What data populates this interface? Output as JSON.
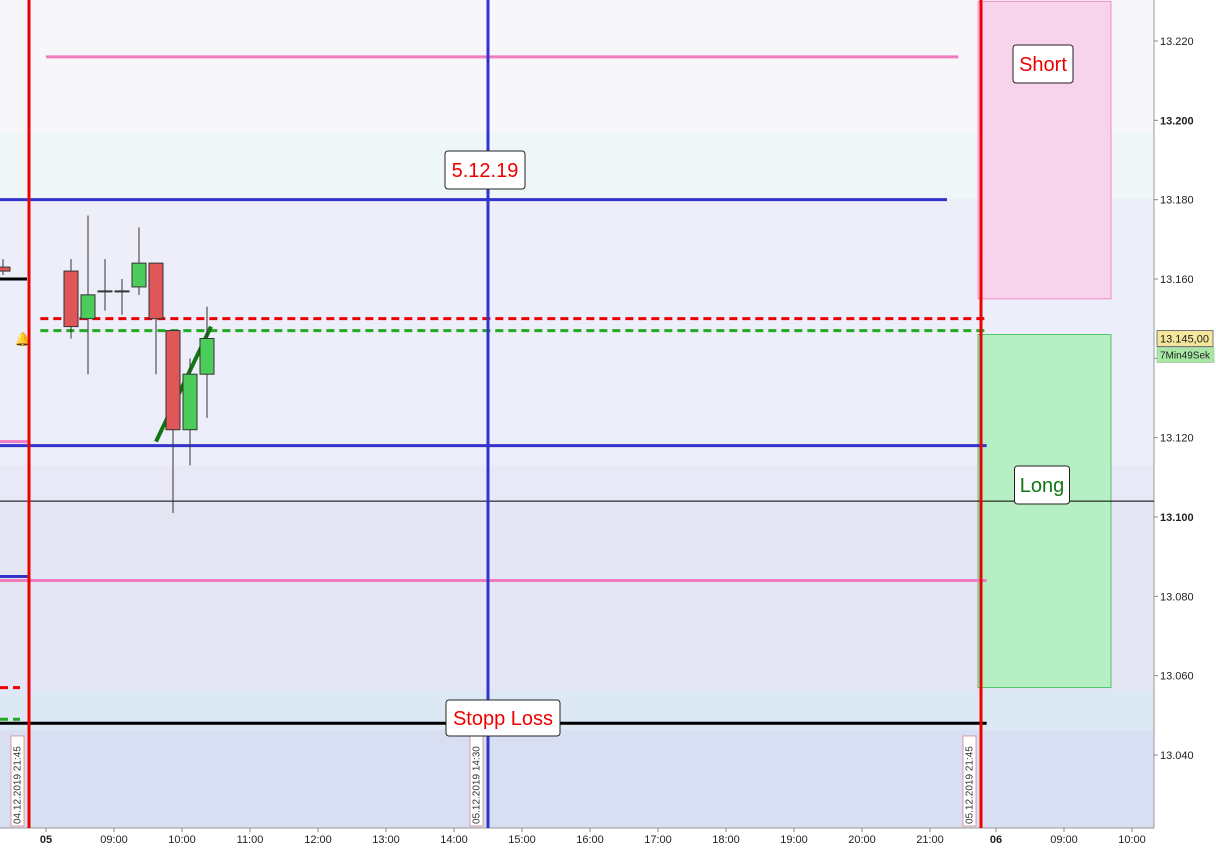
{
  "chart_data": {
    "type": "candlestick",
    "instrument_price_unit": "points",
    "ylim": [
      13025,
      13230
    ],
    "y_axis_ticks": [
      "13.040",
      "13.060",
      "13.080",
      "13.100",
      "13.120",
      "13.140",
      "13.160",
      "13.180",
      "13.200",
      "13.220"
    ],
    "y_axis_bold_ticks": [
      "13.100",
      "13.200"
    ],
    "x_axis_ticks": [
      {
        "label": "05",
        "time": "2019-12-05 08:00",
        "bold": true
      },
      {
        "label": "09:00",
        "time": "2019-12-05 09:00"
      },
      {
        "label": "10:00",
        "time": "2019-12-05 10:00"
      },
      {
        "label": "11:00",
        "time": "2019-12-05 11:00"
      },
      {
        "label": "12:00",
        "time": "2019-12-05 12:00"
      },
      {
        "label": "13:00",
        "time": "2019-12-05 13:00"
      },
      {
        "label": "14:00",
        "time": "2019-12-05 14:00"
      },
      {
        "label": "15:00",
        "time": "2019-12-05 15:00"
      },
      {
        "label": "16:00",
        "time": "2019-12-05 16:00"
      },
      {
        "label": "17:00",
        "time": "2019-12-05 17:00"
      },
      {
        "label": "18:00",
        "time": "2019-12-05 18:00"
      },
      {
        "label": "19:00",
        "time": "2019-12-05 19:00"
      },
      {
        "label": "20:00",
        "time": "2019-12-05 20:00"
      },
      {
        "label": "21:00",
        "time": "2019-12-05 21:00"
      },
      {
        "label": "06",
        "time": "2019-12-06 08:00",
        "bold": true
      },
      {
        "label": "09:00",
        "time": "2019-12-06 09:00"
      },
      {
        "label": "10:00",
        "time": "2019-12-06 10:00"
      }
    ],
    "candles": [
      {
        "time": "2019-12-04 21:00",
        "open": 13163,
        "high": 13165,
        "low": 13162,
        "close": 13164
      },
      {
        "time": "2019-12-04 21:15",
        "open": 13163,
        "high": 13165,
        "low": 13161,
        "close": 13162
      },
      {
        "time": "2019-12-05 08:15",
        "open": 13162,
        "high": 13165,
        "low": 13145,
        "close": 13148
      },
      {
        "time": "2019-12-05 08:30",
        "open": 13150,
        "high": 13176,
        "low": 13136,
        "close": 13156
      },
      {
        "time": "2019-12-05 08:45",
        "open": 13157,
        "high": 13165,
        "low": 13152,
        "close": 13157
      },
      {
        "time": "2019-12-05 09:00",
        "open": 13157,
        "high": 13160,
        "low": 13151,
        "close": 13157
      },
      {
        "time": "2019-12-05 09:15",
        "open": 13158,
        "high": 13173,
        "low": 13156,
        "close": 13164
      },
      {
        "time": "2019-12-05 09:30",
        "open": 13164,
        "high": 13164,
        "low": 13136,
        "close": 13150
      },
      {
        "time": "2019-12-05 09:45",
        "open": 13147,
        "high": 13147,
        "low": 13101,
        "close": 13122
      },
      {
        "time": "2019-12-05 10:00",
        "open": 13122,
        "high": 13140,
        "low": 13113,
        "close": 13136
      },
      {
        "time": "2019-12-05 10:15",
        "open": 13136,
        "high": 13153,
        "low": 13125,
        "close": 13145
      }
    ],
    "horizontal_lines": [
      {
        "role": "top-line",
        "price": 13216,
        "color": "#f07cbf",
        "style": "solid",
        "from": "2019-12-05 08:00",
        "to": "2019-12-05 21:25"
      },
      {
        "role": "resistance",
        "price": 13180,
        "color": "#3333cc",
        "style": "solid",
        "from": "2019-12-04 21:00",
        "to": "2019-12-05 21:15"
      },
      {
        "role": "red-dashed",
        "price": 13150,
        "color": "#ee0000",
        "style": "dashed",
        "from": "2019-12-04 21:55",
        "to": "2019-12-05 21:50"
      },
      {
        "role": "green-dashed",
        "price": 13147,
        "color": "#22aa22",
        "style": "dashed",
        "from": "2019-12-04 21:55",
        "to": "2019-12-05 21:50"
      },
      {
        "role": "support",
        "price": 13118,
        "color": "#3333cc",
        "style": "solid",
        "from": "2019-12-04 21:15",
        "to": "2019-12-05 21:50"
      },
      {
        "role": "current-price",
        "price": 13104,
        "color": "#000000",
        "style": "thin",
        "from": "2019-12-04 20:45",
        "to": "2019-12-06 11:00"
      },
      {
        "role": "bottom-line",
        "price": 13084,
        "color": "#f07cbf",
        "style": "solid",
        "from": "2019-12-04 21:15",
        "to": "2019-12-05 21:50"
      },
      {
        "role": "stop-loss",
        "price": 13048,
        "color": "#000000",
        "style": "solid",
        "from": "2019-12-04 21:15",
        "to": "2019-12-05 21:50"
      }
    ],
    "trend_line": {
      "color": "#117711",
      "from": {
        "time": "2019-12-05 09:45",
        "price": 13119
      },
      "to": {
        "time": "2019-12-05 10:15",
        "price": 13148
      }
    },
    "zones": [
      {
        "name": "short-zone",
        "from_price": 13155,
        "to_price": 13230,
        "color": "#f7d4ec"
      },
      {
        "name": "long-zone",
        "from_price": 13057,
        "to_price": 13146,
        "color": "#b7efc4"
      }
    ],
    "vertical_lines": [
      {
        "time": "2019-12-04 21:45",
        "label": "04.12.2019 21:45",
        "color": "#ee0000"
      },
      {
        "time": "2019-12-05 14:30",
        "label": "05.12.2019 14:30",
        "color": "#3333cc"
      },
      {
        "time": "2019-12-05 21:45",
        "label": "05.12.2019 21:45",
        "color": "#ee0000"
      }
    ],
    "annotations": [
      {
        "name": "short-label",
        "text": "Short",
        "color": "#ee0000"
      },
      {
        "name": "date-label",
        "text": "5.12.19",
        "color": "#ee0000"
      },
      {
        "name": "long-label",
        "text": "Long",
        "color": "#117711"
      },
      {
        "name": "stop-loss-label",
        "text": "Stopp Loss",
        "color": "#ee0000"
      }
    ],
    "price_marker": {
      "value": "13.145,00",
      "price": 13145
    },
    "countdown": "7Min49Sek"
  }
}
